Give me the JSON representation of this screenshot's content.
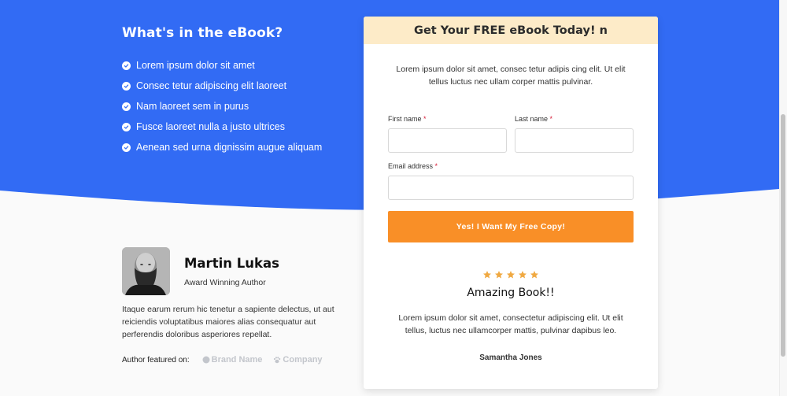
{
  "colors": {
    "hero_blue": "#326bf4",
    "card_header_bg": "#fdebc8",
    "button_orange": "#f98f27",
    "star_color": "#f0a942",
    "required_marker": "#d6203a",
    "brand_gray": "#c3c6cc"
  },
  "features": {
    "title": "What's in the eBook?",
    "items": [
      {
        "icon": "check-circle-icon",
        "text": "Lorem ipsum dolor sit amet"
      },
      {
        "icon": "check-circle-icon",
        "text": "Consec tetur adipiscing elit laoreet"
      },
      {
        "icon": "check-circle-icon",
        "text": "Nam laoreet sem in purus"
      },
      {
        "icon": "check-circle-icon",
        "text": "Fusce laoreet nulla a justo ultrices"
      },
      {
        "icon": "check-circle-icon",
        "text": "Aenean sed urna dignissim augue aliquam"
      }
    ]
  },
  "signup": {
    "header": "Get Your FREE eBook Today! n",
    "intro": "Lorem ipsum dolor sit amet, consec tetur adipis cing elit. Ut elit tellus luctus nec ullam corper mattis pulvinar.",
    "required_marker": "*",
    "fields": {
      "first_name": {
        "label": "First name",
        "value": "",
        "placeholder": ""
      },
      "last_name": {
        "label": "Last name",
        "value": "",
        "placeholder": ""
      },
      "email": {
        "label": "Email address",
        "value": "",
        "placeholder": ""
      }
    },
    "submit_label": "Yes! I Want My Free Copy!"
  },
  "review": {
    "rating": 5,
    "max_rating": 5,
    "title": "Amazing Book!!",
    "text": "Lorem ipsum dolor sit amet, consectetur adipiscing elit. Ut elit tellus, luctus nec ullamcorper mattis, pulvinar dapibus leo.",
    "reviewer": "Samantha Jones"
  },
  "author": {
    "name": "Martin Lukas",
    "role": "Award Winning Author",
    "bio": "Itaque earum rerum hic tenetur a sapiente delectus, ut aut reiciendis voluptatibus maiores alias consequatur aut perferendis doloribus asperiores repellat.",
    "featured_label": "Author featured on:",
    "brands": [
      {
        "icon": "circle-logo-icon",
        "name": "Brand Name"
      },
      {
        "icon": "paw-logo-icon",
        "name": "Company"
      }
    ]
  }
}
